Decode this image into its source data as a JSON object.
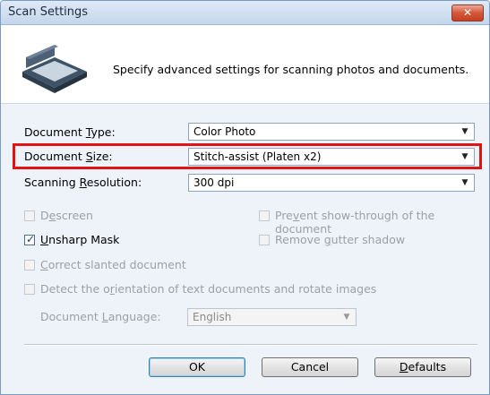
{
  "window": {
    "title": "Scan Settings",
    "close_label": "✕"
  },
  "header": {
    "description": "Specify advanced settings for scanning photos and documents."
  },
  "fields": {
    "document_type": {
      "label_pre": "Document ",
      "label_key": "T",
      "label_post": "ype:",
      "value": "Color Photo"
    },
    "document_size": {
      "label_pre": "Document ",
      "label_key": "S",
      "label_post": "ize:",
      "value": "Stitch-assist (Platen x2)"
    },
    "scanning_resolution": {
      "label_pre": "Scanning ",
      "label_key": "R",
      "label_post": "esolution:",
      "value": "300 dpi"
    }
  },
  "options": {
    "descreen": {
      "label_pre": "D",
      "label_key": "e",
      "label_post": "screen",
      "checked": false,
      "enabled": false
    },
    "unsharp_mask": {
      "label_pre": "",
      "label_key": "U",
      "label_post": "nsharp Mask",
      "checked": true,
      "enabled": true
    },
    "correct_slanted": {
      "label_pre": "",
      "label_key": "C",
      "label_post": "orrect slanted document",
      "checked": false,
      "enabled": false
    },
    "detect_orientation": {
      "label_pre": "Detect the o",
      "label_key": "r",
      "label_post": "ientation of text documents and rotate images",
      "checked": false,
      "enabled": false
    },
    "prevent_showthrough": {
      "label_pre": "Pre",
      "label_key": "v",
      "label_post": "ent show-through of the document",
      "checked": false,
      "enabled": false
    },
    "remove_gutter": {
      "label_pre": "Remove ",
      "label_key": "g",
      "label_post": "utter shadow",
      "checked": false,
      "enabled": false
    }
  },
  "document_language": {
    "label_pre": "Document ",
    "label_key": "L",
    "label_post": "anguage:",
    "value": "English"
  },
  "buttons": {
    "ok": "OK",
    "cancel": "Cancel",
    "defaults_key": "D",
    "defaults_post": "efaults"
  },
  "colors": {
    "highlight": "#e21313",
    "title_bar": "#c4d6ec",
    "dialog_bg": "#eef3fa"
  }
}
